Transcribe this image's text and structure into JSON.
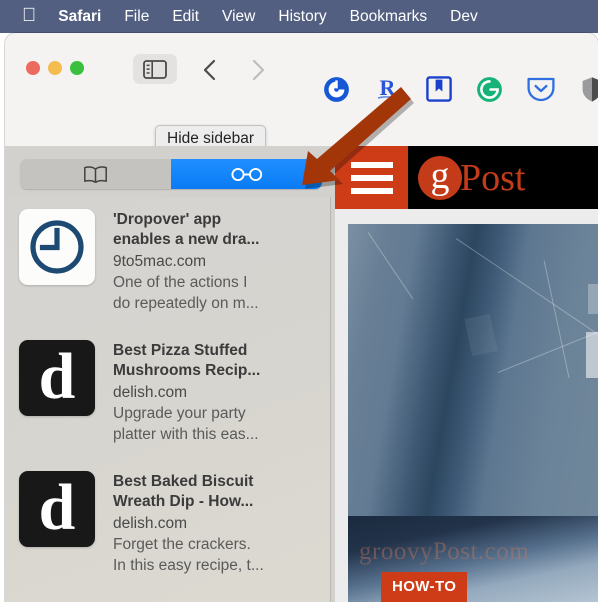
{
  "menubar": {
    "apple_icon": "apple-logo-icon",
    "items": [
      {
        "label": "Safari",
        "bold": true
      },
      {
        "label": "File",
        "bold": false
      },
      {
        "label": "Edit",
        "bold": false
      },
      {
        "label": "View",
        "bold": false
      },
      {
        "label": "History",
        "bold": false
      },
      {
        "label": "Bookmarks",
        "bold": false
      },
      {
        "label": "Dev",
        "bold": false
      }
    ],
    "background_color": "#525f81",
    "text_color": "#ffffff"
  },
  "toolbar": {
    "traffic_lights": [
      {
        "name": "close",
        "color": "#ec6a5e"
      },
      {
        "name": "minimize",
        "color": "#f5bd4f"
      },
      {
        "name": "maximize",
        "color": "#3ac03e"
      }
    ],
    "sidebar_toggle_icon": "sidebar-panel-icon",
    "back_icon": "chevron-left-icon",
    "forward_icon": "chevron-right-icon",
    "extensions": [
      {
        "name": "coinbase-icon",
        "glyph": "C",
        "color": "#1657d6"
      },
      {
        "name": "readwise-icon",
        "glyph": "R",
        "color": "#2856d6"
      },
      {
        "name": "bookmark-icon",
        "glyph": "bookmark",
        "color": "#1b41cc"
      },
      {
        "name": "grammarly-icon",
        "glyph": "G",
        "color": "#16b378"
      },
      {
        "name": "pocket-icon",
        "glyph": "chevron-down",
        "color": "#2f6fe0"
      },
      {
        "name": "shield-icon",
        "glyph": "shield",
        "color": "#59595c"
      }
    ]
  },
  "tooltip": {
    "text": "Hide sidebar"
  },
  "sidebar": {
    "segmented_control": {
      "tabs": [
        {
          "name": "bookmarks-tab",
          "icon": "book-icon",
          "selected": false
        },
        {
          "name": "reading-list-tab",
          "icon": "glasses-icon",
          "selected": true
        }
      ],
      "active_color": "#0a7bf5"
    },
    "reading_list": [
      {
        "favicon": "clock-icon",
        "favicon_style": "white",
        "title_line1": "'Dropover' app",
        "title_line2": "enables a new dra...",
        "domain": "9to5mac.com",
        "snippet_line1": "One of the actions I",
        "snippet_line2": "do repeatedly on m..."
      },
      {
        "favicon": "delish-d-icon",
        "favicon_style": "black",
        "title_line1": "Best Pizza Stuffed",
        "title_line2": "Mushrooms Recip...",
        "domain": "delish.com",
        "snippet_line1": "Upgrade your party",
        "snippet_line2": "platter with this eas..."
      },
      {
        "favicon": "delish-d-icon",
        "favicon_style": "black",
        "title_line1": "Best Baked Biscuit",
        "title_line2": "Wreath Dip - How...",
        "domain": "delish.com",
        "snippet_line1": "Forget the crackers.",
        "snippet_line2": "In this easy recipe, t..."
      }
    ]
  },
  "page": {
    "site_header": {
      "menu_icon": "hamburger-menu-icon",
      "menu_bg_color": "#cd3c17",
      "logo_mark": "g",
      "logo_word": "Post",
      "logo_color": "#c33b19"
    },
    "hero": {
      "watermark": "groovyPost.com",
      "badge": "HOW-TO",
      "badge_color": "#cd3c17"
    }
  },
  "annotation": {
    "arrow": {
      "name": "pointer-arrow",
      "color": "#a23608",
      "points_to": "reading-list-tab"
    }
  }
}
